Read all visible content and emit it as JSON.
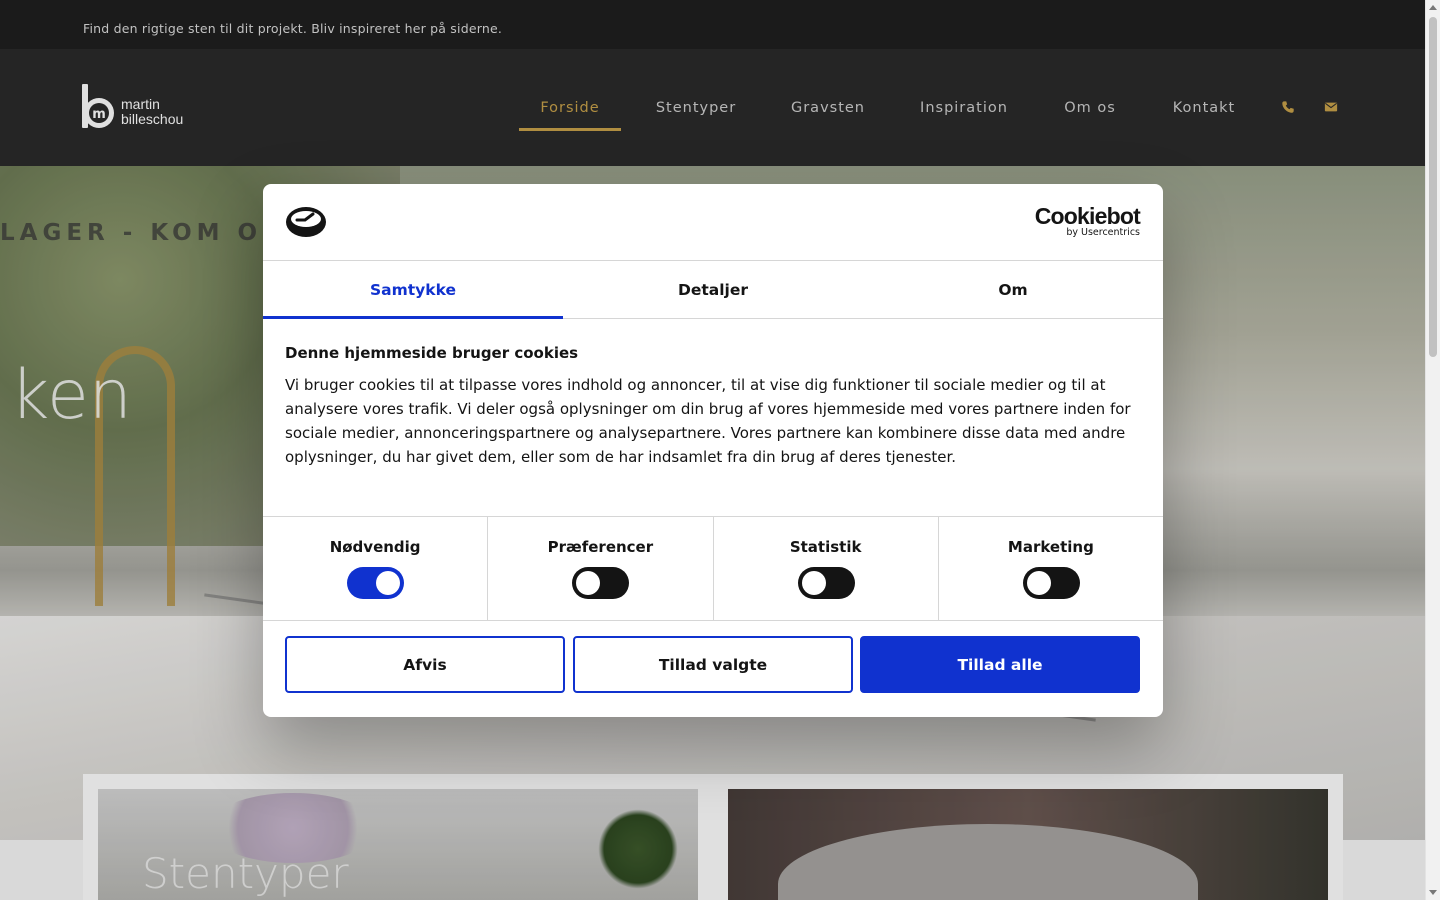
{
  "topbar": {
    "tagline": "Find den rigtige sten til dit projekt. Bliv inspireret her på siderne."
  },
  "header": {
    "logo": {
      "line1": "martin",
      "line2": "billeschou"
    },
    "nav": [
      {
        "label": "Forside",
        "active": true
      },
      {
        "label": "Stentyper",
        "active": false
      },
      {
        "label": "Gravsten",
        "active": false
      },
      {
        "label": "Inspiration",
        "active": false
      },
      {
        "label": "Om os",
        "active": false
      },
      {
        "label": "Kontakt",
        "active": false
      }
    ],
    "icons": [
      "phone-icon",
      "envelope-icon"
    ],
    "accent_color": "#c9a24a"
  },
  "hero": {
    "ribbon_text": "LAGER - KOM OG F",
    "title_fragment": "ken"
  },
  "cards": [
    {
      "label": "Stentyper"
    },
    {
      "label": ""
    }
  ],
  "cookie_dialog": {
    "brand": {
      "name": "Cookiebot",
      "by": "by Usercentrics"
    },
    "tabs": [
      {
        "label": "Samtykke",
        "active": true
      },
      {
        "label": "Detaljer",
        "active": false
      },
      {
        "label": "Om",
        "active": false
      }
    ],
    "heading": "Denne hjemmeside bruger cookies",
    "body": "Vi bruger cookies til at tilpasse vores indhold og annoncer, til at vise dig funktioner til sociale medier og til at analysere vores trafik. Vi deler også oplysninger om din brug af vores hjemmeside med vores partnere inden for sociale medier, annonceringspartnere og analysepartnere. Vores partnere kan kombinere disse data med andre oplysninger, du har givet dem, eller som de har indsamlet fra din brug af deres tjenester.",
    "toggles": [
      {
        "label": "Nødvendig",
        "on": true
      },
      {
        "label": "Præferencer",
        "on": false
      },
      {
        "label": "Statistik",
        "on": false
      },
      {
        "label": "Marketing",
        "on": false
      }
    ],
    "buttons": {
      "reject": "Afvis",
      "allow_selected": "Tillad valgte",
      "allow_all": "Tillad alle"
    },
    "accent_color": "#1032cf"
  }
}
